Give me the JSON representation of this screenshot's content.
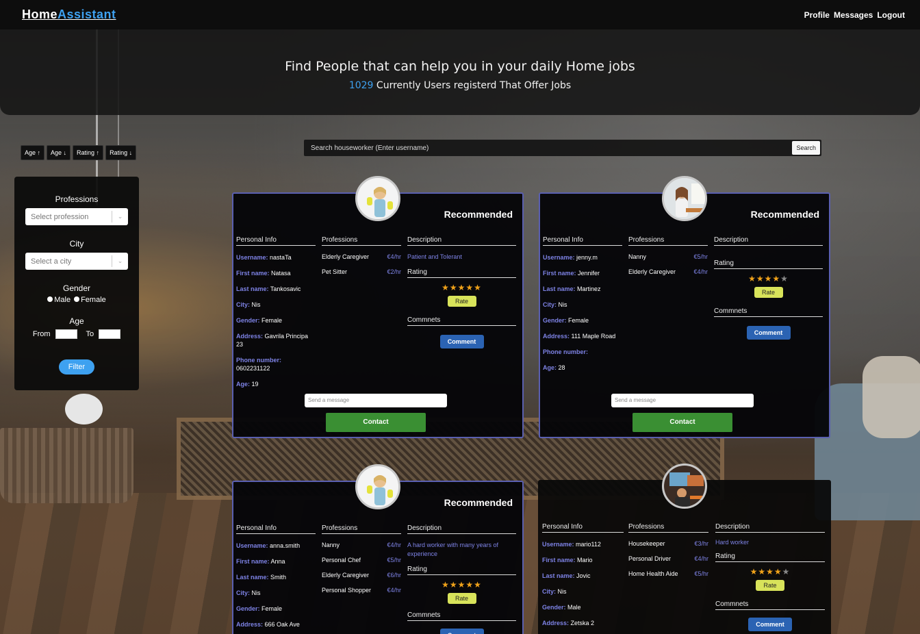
{
  "navbar": {
    "brand_home": "Home",
    "brand_assistant": "Assistant",
    "links": [
      "Profile",
      "Messages",
      "Logout"
    ]
  },
  "hero": {
    "title": "Find People that can help you in your daily Home jobs",
    "count": "1029",
    "subtitle": "Currently Users registerd That Offer Jobs"
  },
  "sort": [
    "Age ↑",
    "Age ↓",
    "Rating ↑",
    "Rating ↓"
  ],
  "filter": {
    "professions_label": "Professions",
    "profession_placeholder": "Select profession",
    "city_label": "City",
    "city_placeholder": "Select a city",
    "gender_label": "Gender",
    "male": "Male",
    "female": "Female",
    "age_label": "Age",
    "from": "From",
    "to": "To",
    "button": "Filter"
  },
  "search": {
    "placeholder": "Search houseworker (Enter username)",
    "button": "Search"
  },
  "labels": {
    "recommended": "Recommended",
    "personal_info": "Personal Info",
    "professions": "Professions",
    "description": "Description",
    "rating": "Rating",
    "comments": "Commnets",
    "rate": "Rate",
    "comment": "Comment",
    "send_message": "Send a message",
    "contact": "Contact",
    "username": "Username:",
    "first_name": "First name:",
    "last_name": "Last name:",
    "city": "City:",
    "gender": "Gender:",
    "address": "Address:",
    "phone": "Phone number:",
    "age": "Age:"
  },
  "cards": [
    {
      "recommended": true,
      "username": "nastaTa",
      "first_name": "Natasa",
      "last_name": "Tankosavic",
      "city": "Nis",
      "gender": "Female",
      "address": "Gavrila Principa 23",
      "phone": "0602231122",
      "age": "19",
      "professions": [
        {
          "name": "Elderly Caregiver",
          "rate": "€4/hr"
        },
        {
          "name": "Pet Sitter",
          "rate": "€2/hr"
        }
      ],
      "description": "Patient and Tolerant",
      "stars": 5
    },
    {
      "recommended": true,
      "username": "jenny.m",
      "first_name": "Jennifer",
      "last_name": "Martinez",
      "city": "Nis",
      "gender": "Female",
      "address": "111 Maple Road",
      "phone": "",
      "age": "28",
      "professions": [
        {
          "name": "Nanny",
          "rate": "€5/hr"
        },
        {
          "name": "Elderly Caregiver",
          "rate": "€4/hr"
        }
      ],
      "description": "",
      "stars": 4
    },
    {
      "recommended": true,
      "username": "anna.smith",
      "first_name": "Anna",
      "last_name": "Smith",
      "city": "Nis",
      "gender": "Female",
      "address": "666 Oak Ave",
      "phone": "",
      "age": "",
      "professions": [
        {
          "name": "Nanny",
          "rate": "€4/hr"
        },
        {
          "name": "Personal Chef",
          "rate": "€5/hr"
        },
        {
          "name": "Elderly Caregiver",
          "rate": "€6/hr"
        },
        {
          "name": "Personal Shopper",
          "rate": "€4/hr"
        }
      ],
      "description": "A hard worker with many years of experience",
      "stars": 5
    },
    {
      "recommended": false,
      "username": "mario112",
      "first_name": "Mario",
      "last_name": "Jovic",
      "city": "Nis",
      "gender": "Male",
      "address": "Zetska 2",
      "phone": "",
      "age": "",
      "professions": [
        {
          "name": "Housekeeper",
          "rate": "€3/hr"
        },
        {
          "name": "Personal Driver",
          "rate": "€4/hr"
        },
        {
          "name": "Home Health Aide",
          "rate": "€5/hr"
        }
      ],
      "description": "Hard worker",
      "stars": 4
    }
  ],
  "colors": {
    "accent_blue": "#3ea1f0",
    "label_purple": "#7e83e6",
    "card_border": "#5a5fb0",
    "contact_green": "#3a8f33",
    "comment_blue": "#2b63b3",
    "rate_yellow": "#d8e35a",
    "star_gold": "#f0a21a"
  }
}
